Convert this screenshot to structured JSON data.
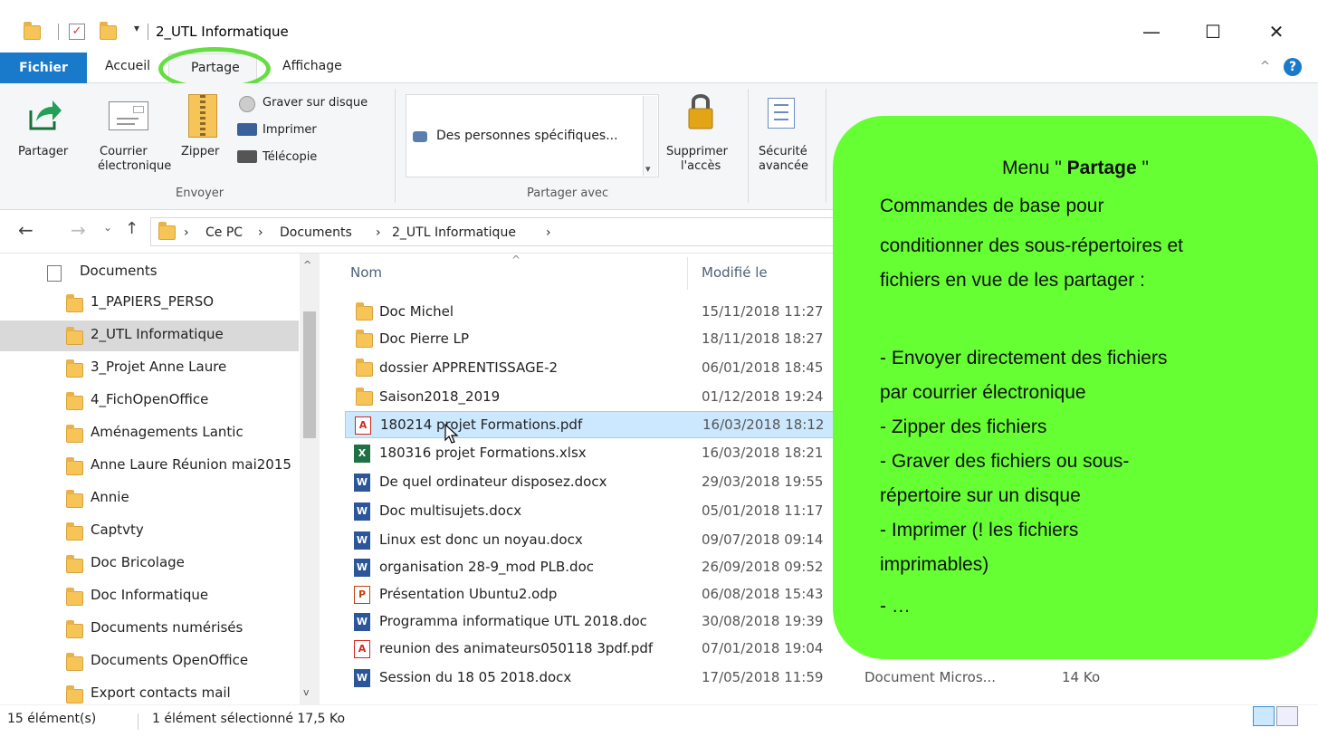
{
  "window": {
    "title": "2_UTL Informatique",
    "minimize": "—",
    "maximize": "☐",
    "close": "✕"
  },
  "ribbon_tabs": {
    "fichier": "Fichier",
    "accueil": "Accueil",
    "partage": "Partage",
    "affichage": "Affichage"
  },
  "ribbon": {
    "partager": "Partager",
    "courrier": "Courrier",
    "courrier2": "électronique",
    "zipper": "Zipper",
    "graver": "Graver sur disque",
    "imprimer": "Imprimer",
    "telecopie": "Télécopie",
    "group_envoyer": "Envoyer",
    "personnes": "Des personnes spécifiques...",
    "supprimer": "Supprimer",
    "supprimer2": "l'accès",
    "group_partager_avec": "Partager avec",
    "securite": "Sécurité",
    "securite2": "avancée"
  },
  "address": {
    "crumbs": [
      "Ce PC",
      "Documents",
      "2_UTL Informatique"
    ],
    "sep": "›"
  },
  "nav": {
    "items": [
      {
        "label": "Documents"
      },
      {
        "label": "1_PAPIERS_PERSO"
      },
      {
        "label": "2_UTL Informatique"
      },
      {
        "label": "3_Projet Anne Laure"
      },
      {
        "label": "4_FichOpenOffice"
      },
      {
        "label": "Aménagements Lantic"
      },
      {
        "label": "Anne Laure Réunion mai2015"
      },
      {
        "label": "Annie"
      },
      {
        "label": "Captvty"
      },
      {
        "label": "Doc Bricolage"
      },
      {
        "label": "Doc Informatique"
      },
      {
        "label": "Documents numérisés"
      },
      {
        "label": "Documents OpenOffice"
      },
      {
        "label": "Export contacts mail"
      }
    ]
  },
  "columns": {
    "name": "Nom",
    "modified": "Modifié le"
  },
  "files": [
    {
      "name": "Doc Michel",
      "date": "15/11/2018 11:27",
      "icon": "folder"
    },
    {
      "name": "Doc Pierre LP",
      "date": "18/11/2018 18:27",
      "icon": "folder"
    },
    {
      "name": "dossier APPRENTISSAGE-2",
      "date": "06/01/2018 18:45",
      "icon": "folder"
    },
    {
      "name": "Saison2018_2019",
      "date": "01/12/2018 19:24",
      "icon": "folder"
    },
    {
      "name": "180214 projet Formations.pdf",
      "date": "16/03/2018 18:12",
      "icon": "pdf"
    },
    {
      "name": "180316 projet Formations.xlsx",
      "date": "16/03/2018 18:21",
      "icon": "xls"
    },
    {
      "name": "De quel ordinateur disposez.docx",
      "date": "29/03/2018 19:55",
      "icon": "doc"
    },
    {
      "name": "Doc multisujets.docx",
      "date": "05/01/2018 11:17",
      "icon": "doc"
    },
    {
      "name": "Linux est donc un noyau.docx",
      "date": "09/07/2018 09:14",
      "icon": "doc"
    },
    {
      "name": "organisation 28-9_mod PLB.doc",
      "date": "26/09/2018 09:52",
      "icon": "doc"
    },
    {
      "name": "Présentation Ubuntu2.odp",
      "date": "06/08/2018 15:43",
      "icon": "odp"
    },
    {
      "name": "Programma informatique UTL 2018.doc",
      "date": "30/08/2018 19:39",
      "icon": "doc"
    },
    {
      "name": "reunion des animateurs050118  3pdf.pdf",
      "date": "07/01/2018 19:04",
      "icon": "pdf"
    },
    {
      "name": "Session du 18 05 2018.docx",
      "date": "17/05/2018 11:59",
      "icon": "doc"
    }
  ],
  "last_row_extra": {
    "type": "Document Micros...",
    "size": "14 Ko"
  },
  "status": {
    "count": "15 élément(s)",
    "selected": "1 élément sélectionné 17,5 Ko"
  },
  "callout": {
    "title_pre": "Menu \"",
    "title_bold": "Partage",
    "title_post": "\"",
    "lines": [
      "Commandes de base pour",
      "conditionner des sous-répertoires et",
      "fichiers en vue de les partager :",
      "",
      "- Envoyer directement des fichiers",
      "par courrier électronique",
      "- Zipper des fichiers",
      "- Graver des fichiers ou sous-",
      "répertoire sur un disque",
      "- Imprimer (! les fichiers",
      "imprimables)",
      "- …"
    ]
  },
  "colors": {
    "accent": "#1979ca",
    "callout": "#66ff33",
    "circle": "#66dd44",
    "selection": "#cce8ff"
  }
}
